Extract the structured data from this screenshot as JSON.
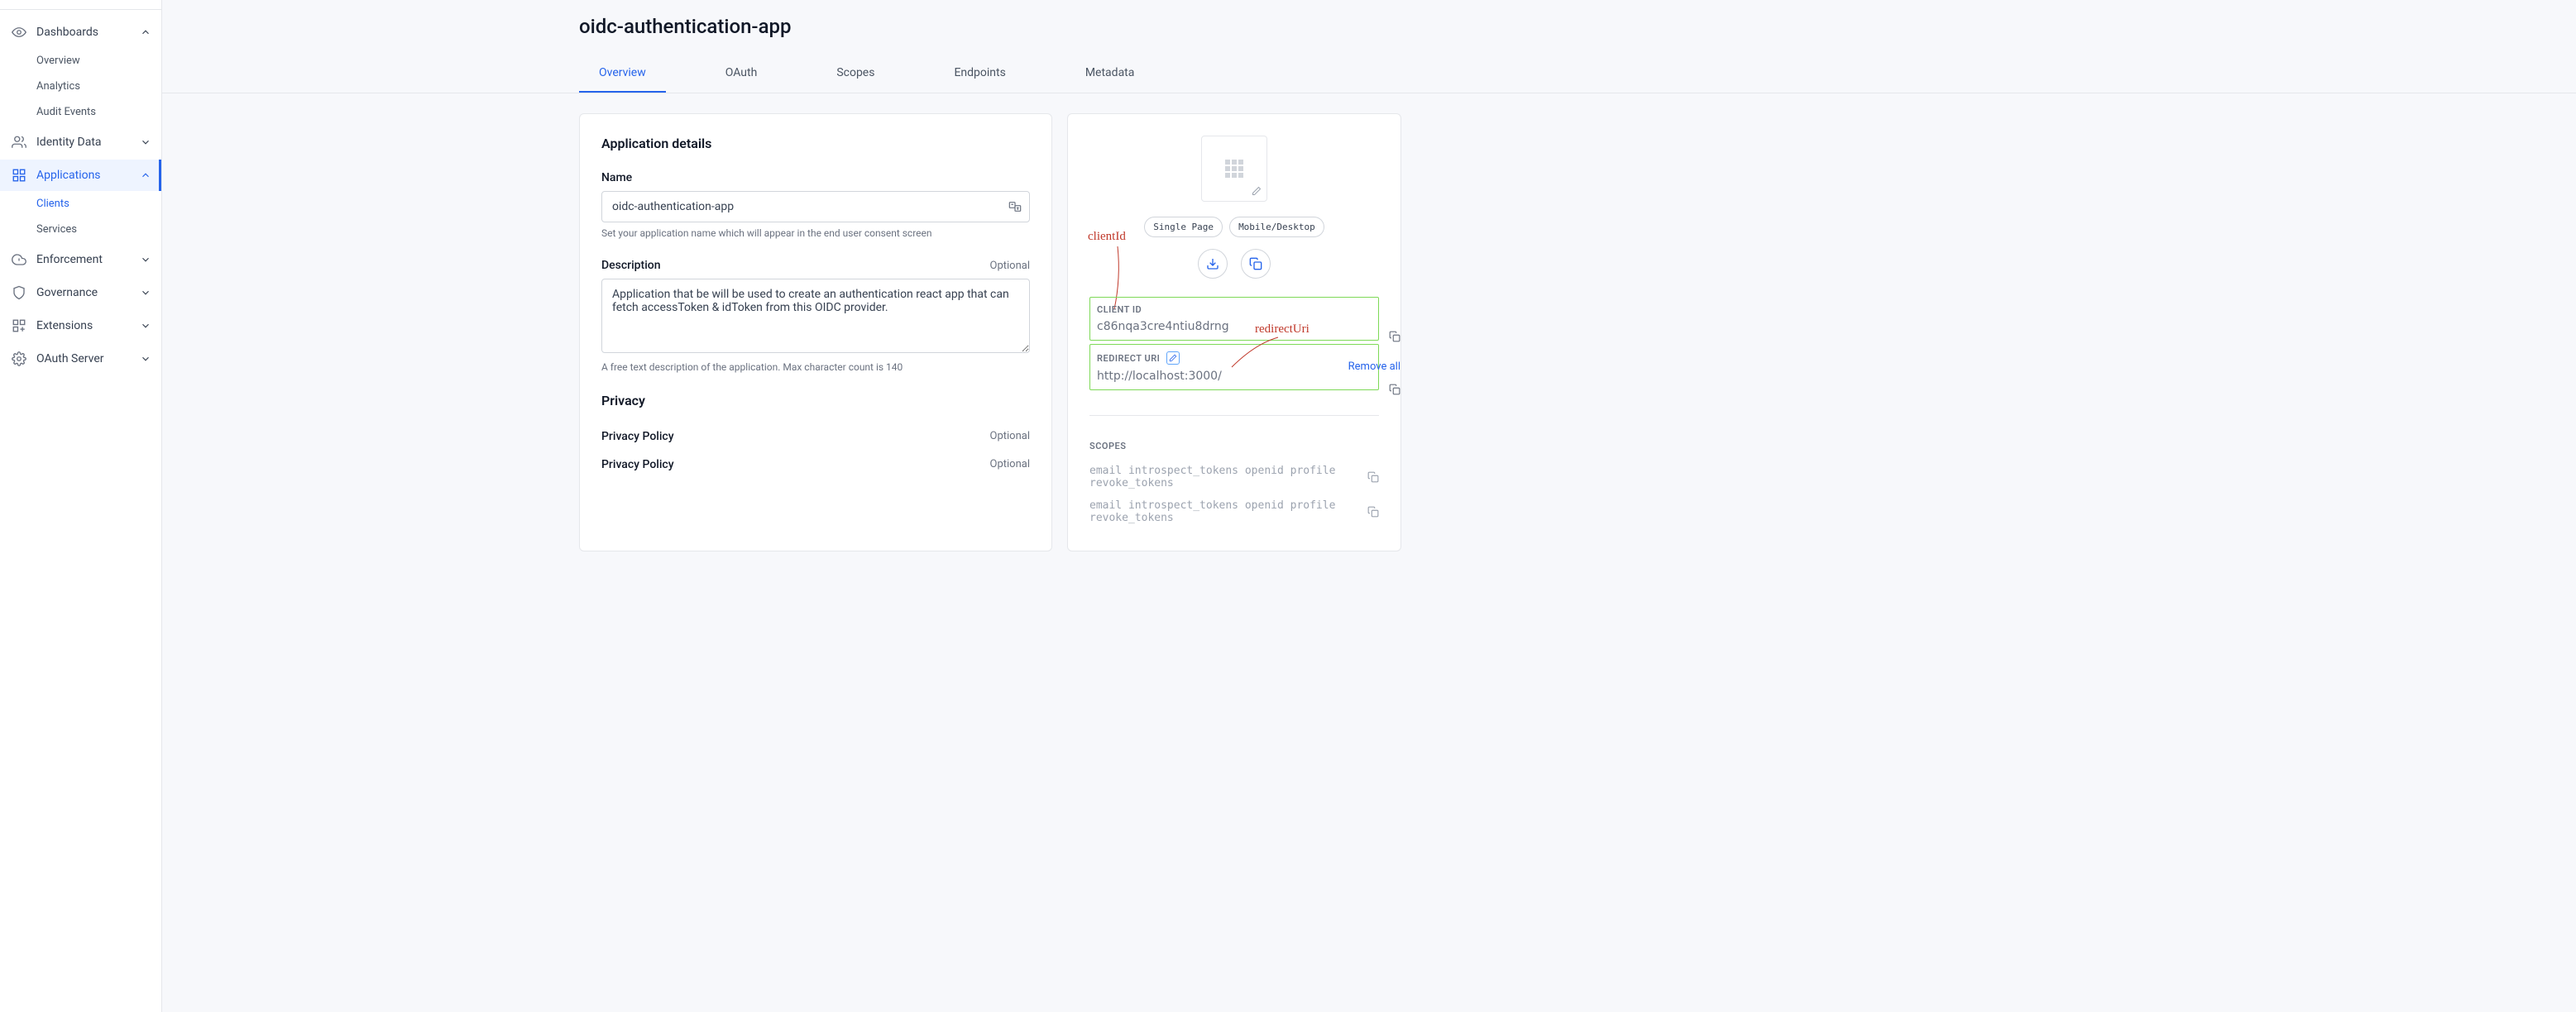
{
  "sidebar": {
    "groups": [
      {
        "label": "Dashboards",
        "expanded": true,
        "items": [
          "Overview",
          "Analytics",
          "Audit Events"
        ]
      },
      {
        "label": "Identity Data",
        "expanded": false
      },
      {
        "label": "Applications",
        "expanded": true,
        "active": true,
        "items": [
          "Clients",
          "Services"
        ],
        "activeItem": 0
      },
      {
        "label": "Enforcement",
        "expanded": false
      },
      {
        "label": "Governance",
        "expanded": false
      },
      {
        "label": "Extensions",
        "expanded": false
      },
      {
        "label": "OAuth Server",
        "expanded": false
      }
    ]
  },
  "page": {
    "title": "oidc-authentication-app"
  },
  "tabs": [
    "Overview",
    "OAuth",
    "Scopes",
    "Endpoints",
    "Metadata"
  ],
  "activeTab": 0,
  "details": {
    "heading": "Application details",
    "name": {
      "label": "Name",
      "value": "oidc-authentication-app",
      "help": "Set your application name which will appear in the end user consent screen"
    },
    "description": {
      "label": "Description",
      "optional": "Optional",
      "value": "Application that be will be used to create an authentication react app that can fetch accessToken & idToken from this OIDC provider.",
      "help": "A free text description of the application. Max character count is 140"
    },
    "privacy": {
      "heading": "Privacy",
      "rows": [
        {
          "label": "Privacy Policy",
          "optional": "Optional"
        },
        {
          "label": "Privacy Policy",
          "optional": "Optional"
        }
      ]
    }
  },
  "summary": {
    "pills": [
      "Single Page",
      "Mobile/Desktop"
    ],
    "clientId": {
      "label": "CLIENT ID",
      "value": "c86nqa3cre4ntiu8drng"
    },
    "redirectUri": {
      "label": "REDIRECT URI",
      "value": "http://localhost:3000/"
    },
    "removeAll": "Remove all",
    "scopes": {
      "label": "SCOPES",
      "lines": [
        "email introspect_tokens openid profile revoke_tokens",
        "email introspect_tokens openid profile revoke_tokens"
      ]
    }
  },
  "annotations": {
    "clientId": "clientId",
    "redirectUri": "redirectUri"
  }
}
